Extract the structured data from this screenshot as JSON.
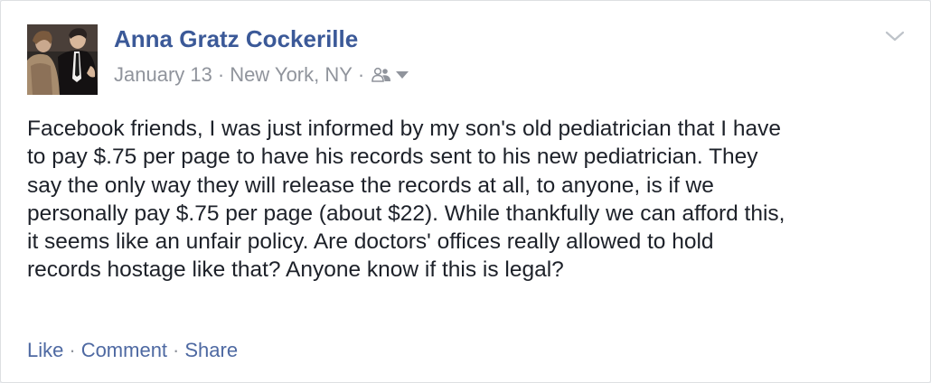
{
  "post": {
    "author": "Anna Gratz Cockerille",
    "date": "January 13",
    "location": "New York, NY",
    "separator": "·",
    "audience_icon": "friends-icon",
    "menu_icon": "chevron-down-icon",
    "text": "Facebook friends, I was just informed by my son's old pediatrician that I have\nto pay $.75 per page to have his records sent to his new pediatrician. They\nsay the only way they will release the records at all, to anyone, is if we\npersonally pay $.75 per page (about $22). While thankfully we can afford this,\nit seems like an unfair policy. Are doctors' offices really allowed to hold\nrecords hostage like that? Anyone know if this is legal?"
  },
  "actions": {
    "like": "Like",
    "comment": "Comment",
    "share": "Share"
  },
  "colors": {
    "link": "#3b5998",
    "action_link": "#4e69a2",
    "meta_text": "#90949c",
    "body_text": "#1d2129"
  }
}
